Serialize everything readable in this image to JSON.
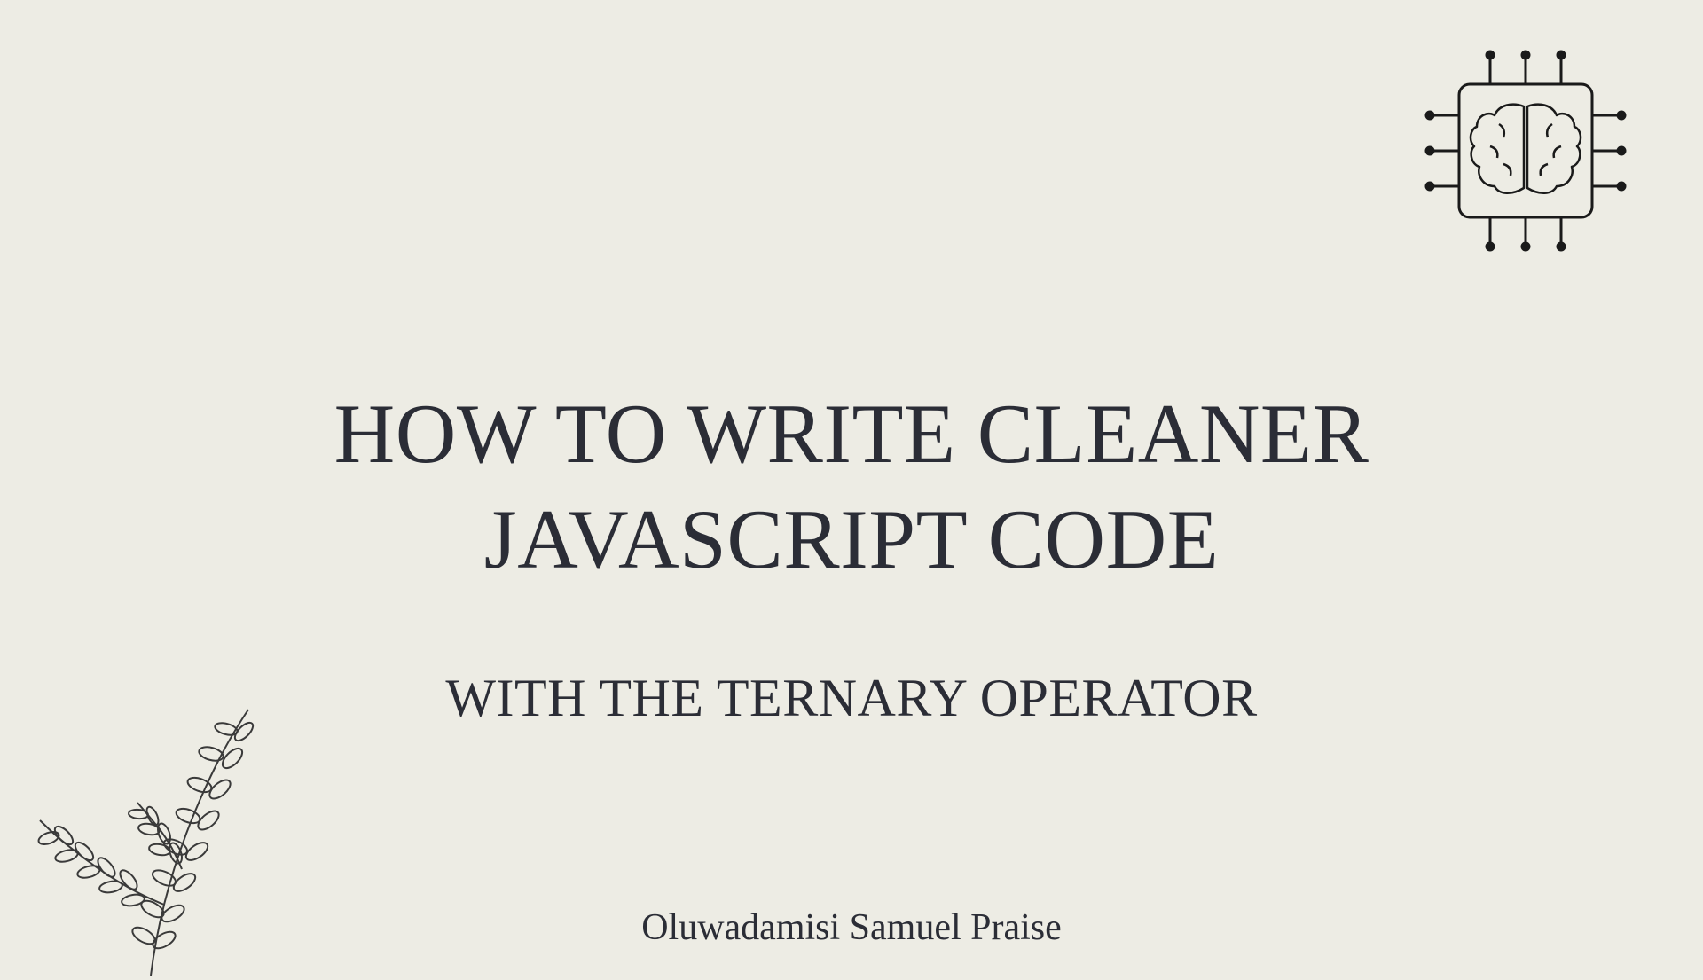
{
  "title_line1": "HOW TO WRITE CLEANER",
  "title_line2": "JAVASCRIPT CODE",
  "subtitle": "WITH THE TERNARY OPERATOR",
  "author": "Oluwadamisi Samuel Praise"
}
